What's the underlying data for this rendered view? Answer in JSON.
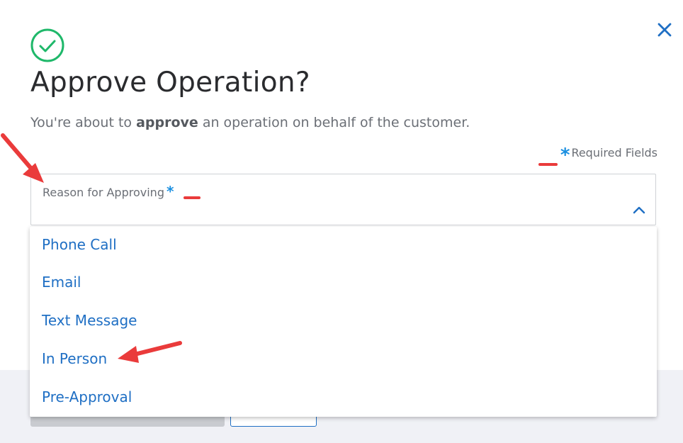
{
  "dialog": {
    "title": "Approve Operation?",
    "subtitle_prefix": "You're about to ",
    "subtitle_bold": "approve",
    "subtitle_suffix": " an operation on behalf of the customer.",
    "required_asterisk": "*",
    "required_text": "Required Fields"
  },
  "select": {
    "label": "Reason for Approving",
    "asterisk": "*",
    "options": [
      "Phone Call",
      "Email",
      "Text Message",
      "In Person",
      "Pre-Approval"
    ]
  },
  "colors": {
    "accent": "#1f6fc4",
    "required_asterisk": "#1a8fe0",
    "success_check": "#1fb86a",
    "annotation": "#ea3b3b"
  },
  "icons": {
    "success": "check-circle-icon",
    "close": "close-icon",
    "chevron": "chevron-up-icon"
  }
}
